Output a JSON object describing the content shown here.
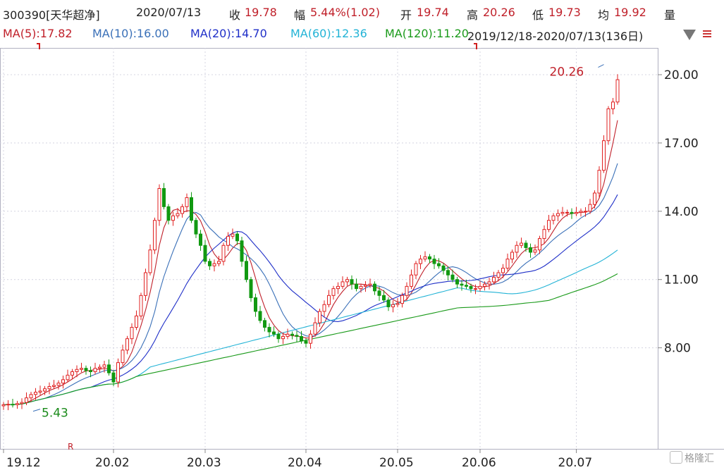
{
  "header": {
    "code": "300390[天华超净]",
    "date": "2020/07/13",
    "close_label": "收",
    "close_value": "19.78",
    "amp_label": "幅",
    "amp_value": "5.44%(1.02)",
    "open_label": "开",
    "open_value": "19.74",
    "high_label": "高",
    "high_value": "20.26",
    "low_label": "低",
    "low_value": "19.73",
    "avg_label": "均",
    "avg_value": "19.92",
    "vol_label": "量"
  },
  "ma_legend": [
    {
      "text": "MA(5):17.82",
      "color": "#c0202a"
    },
    {
      "text": "MA(10):16.00",
      "color": "#3a70b8"
    },
    {
      "text": "MA(20):14.70",
      "color": "#1f2fc8"
    },
    {
      "text": "MA(60):12.36",
      "color": "#22b3d6"
    },
    {
      "text": "MA(120):11.20",
      "color": "#1a9a1a"
    }
  ],
  "range_text": "2019/12/18-2020/07/13(136日)",
  "watermark": "格隆汇",
  "colors": {
    "up": "#e02020",
    "down": "#119911",
    "text_red": "#c0202a",
    "text_green": "#1a8a1a",
    "grid": "#b0b0c0"
  },
  "icons": [
    "dropdown-triangle-icon",
    "menu-lines-icon",
    "watermark-logo-icon"
  ],
  "chart_data": {
    "type": "candlestick",
    "y_ticks": [
      "20.00",
      "17.00",
      "14.00",
      "11.00",
      "8.00"
    ],
    "ylim": [
      4.0,
      21.0
    ],
    "x_ticks": [
      {
        "label": "19.12",
        "index": 0
      },
      {
        "label": "20.02",
        "index": 24
      },
      {
        "label": "20.03",
        "index": 44
      },
      {
        "label": "20.04",
        "index": 66
      },
      {
        "label": "20.05",
        "index": 86
      },
      {
        "label": "20.06",
        "index": 104
      },
      {
        "label": "20.07",
        "index": 125
      }
    ],
    "annotations": [
      {
        "text": "20.26",
        "index": 131,
        "value": 20.26,
        "color": "#c0202a"
      },
      {
        "text": "5.43",
        "index": 4,
        "value": 5.43,
        "color": "#1a8a1a"
      },
      {
        "text": "R",
        "index": 14,
        "value": 4.55,
        "color": "#c0202a"
      }
    ],
    "close": [
      5.5,
      5.52,
      5.5,
      5.55,
      5.6,
      5.8,
      5.95,
      6.05,
      6.1,
      6.2,
      6.3,
      6.35,
      6.45,
      6.6,
      6.8,
      6.95,
      7.05,
      7.1,
      7.0,
      6.95,
      7.1,
      7.15,
      7.25,
      6.9,
      6.5,
      7.35,
      7.9,
      8.4,
      8.9,
      9.4,
      10.3,
      11.3,
      12.3,
      13.6,
      15.0,
      14.2,
      13.6,
      13.8,
      13.9,
      14.2,
      14.6,
      13.6,
      13.0,
      12.5,
      11.8,
      11.6,
      11.7,
      11.8,
      12.5,
      12.9,
      13.0,
      12.7,
      11.8,
      11.0,
      10.2,
      9.6,
      9.2,
      8.9,
      8.7,
      8.6,
      8.4,
      8.5,
      8.6,
      8.55,
      8.5,
      8.3,
      8.2,
      8.6,
      9.1,
      9.6,
      9.9,
      10.3,
      10.6,
      10.7,
      10.9,
      11.0,
      10.8,
      10.6,
      10.7,
      10.75,
      10.8,
      10.5,
      10.3,
      10.1,
      9.8,
      9.9,
      9.95,
      10.3,
      10.7,
      11.2,
      11.7,
      11.9,
      12.0,
      11.9,
      11.7,
      11.6,
      11.4,
      11.2,
      11.0,
      10.8,
      10.75,
      10.7,
      10.6,
      10.6,
      10.7,
      10.8,
      10.9,
      11.1,
      11.3,
      11.5,
      11.9,
      12.2,
      12.5,
      12.6,
      12.4,
      12.2,
      12.3,
      12.8,
      13.2,
      13.6,
      13.8,
      13.9,
      13.95,
      13.95,
      13.9,
      13.95,
      14.0,
      14.0,
      14.3,
      14.8,
      15.8,
      17.1,
      18.5,
      18.8,
      19.78
    ]
  }
}
